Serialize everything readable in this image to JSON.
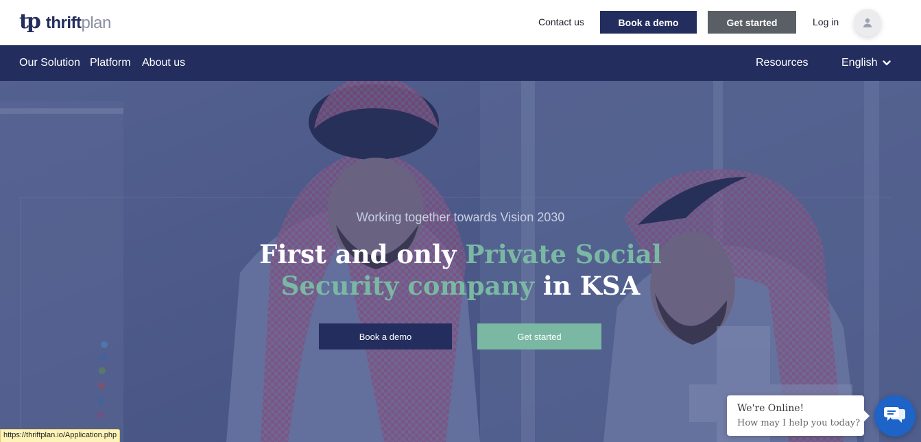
{
  "brand": {
    "mark": "tp",
    "name_bold": "thrift",
    "name_light": "plan"
  },
  "header": {
    "contact_label": "Contact us",
    "book_demo_label": "Book a demo",
    "get_started_label": "Get started",
    "login_label": "Log in",
    "avatar_icon": "user-icon"
  },
  "nav": {
    "items": [
      {
        "label": "Our Solution"
      },
      {
        "label": "Platform"
      },
      {
        "label": "About us"
      }
    ],
    "resources_label": "Resources",
    "language_label": "English",
    "language_icon": "chevron-down-icon"
  },
  "hero": {
    "tagline": "Working together towards Vision 2030",
    "headline_1": "First and only ",
    "headline_2": "Private Social",
    "headline_3": "Security company",
    "headline_4": " in KSA",
    "book_demo_label": "Book a demo",
    "get_started_label": "Get started"
  },
  "chat": {
    "title": "We're Online!",
    "subtitle": "How may I help you today?",
    "icon": "chat-icon"
  },
  "status_bar": {
    "url": "https://thriftplan.io/Application.php"
  },
  "colors": {
    "navy": "#232d5e",
    "gray_button": "#5a5f65",
    "accent_green": "#7ab8a4",
    "chat_blue": "#1d63c8"
  }
}
